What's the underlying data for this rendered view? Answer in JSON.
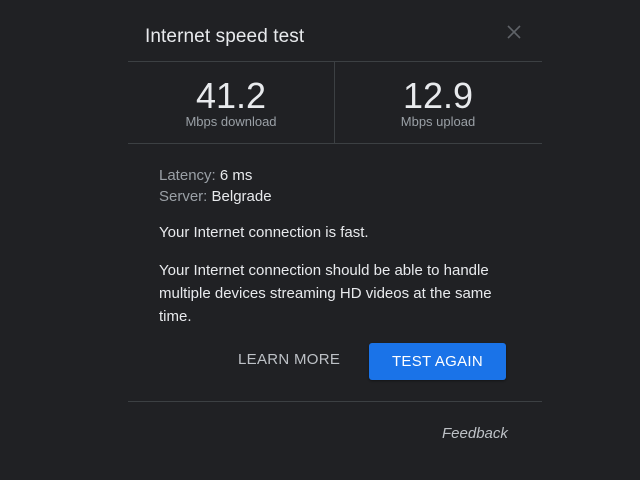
{
  "dialog": {
    "title": "Internet speed test"
  },
  "results": {
    "download": {
      "value": "41.2",
      "label": "Mbps download"
    },
    "upload": {
      "value": "12.9",
      "label": "Mbps upload"
    }
  },
  "details": {
    "latency_label": "Latency:",
    "latency_value": "6 ms",
    "server_label": "Server:",
    "server_value": "Belgrade",
    "verdict": "Your Internet connection is fast.",
    "explanation_line1": "Your Internet connection should be able to handle",
    "explanation_line2": "multiple devices streaming HD videos at the same",
    "explanation_line3": "time."
  },
  "actions": {
    "learn_more": "LEARN MORE",
    "test_again": "TEST AGAIN",
    "feedback": "Feedback"
  },
  "icons": {
    "close": "close-icon"
  },
  "colors": {
    "background": "#202124",
    "accent": "#1a73e8",
    "divider": "#3c4043",
    "text_primary": "#e8eaed",
    "text_secondary": "#9aa0a6"
  }
}
